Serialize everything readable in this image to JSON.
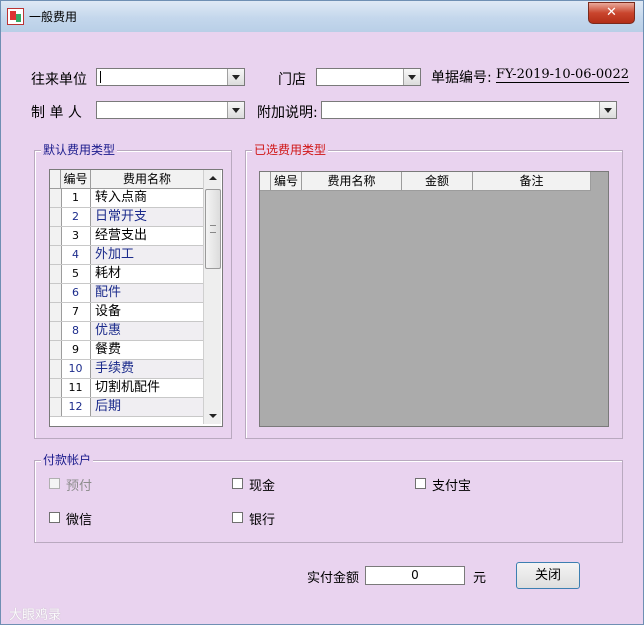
{
  "window": {
    "title": "一般费用",
    "close_symbol": "✕"
  },
  "form": {
    "partner_label": "往来单位",
    "partner_value": "",
    "store_label": "门店",
    "store_value": "",
    "bill_no_label": "单据编号:",
    "bill_no_value": "FY-2019-10-06-0022",
    "creator_label": "制 单 人",
    "creator_value": "",
    "note_label": "附加说明:",
    "note_value": ""
  },
  "default_types": {
    "title": "默认费用类型",
    "columns": [
      "编号",
      "费用名称"
    ],
    "rows": [
      {
        "no": "1",
        "name": "转入点商"
      },
      {
        "no": "2",
        "name": "日常开支"
      },
      {
        "no": "3",
        "name": "经营支出"
      },
      {
        "no": "4",
        "name": "外加工"
      },
      {
        "no": "5",
        "name": "耗材"
      },
      {
        "no": "6",
        "name": "配件"
      },
      {
        "no": "7",
        "name": "设备"
      },
      {
        "no": "8",
        "name": "优惠"
      },
      {
        "no": "9",
        "name": "餐费"
      },
      {
        "no": "10",
        "name": "手续费"
      },
      {
        "no": "11",
        "name": "切割机配件"
      },
      {
        "no": "12",
        "name": "后期"
      }
    ]
  },
  "selected_types": {
    "title": "已选费用类型",
    "columns": [
      "编号",
      "费用名称",
      "金额",
      "备注"
    ]
  },
  "payment": {
    "title": "付款帐户",
    "options": [
      {
        "label": "预付",
        "checked": false,
        "disabled": true
      },
      {
        "label": "现金",
        "checked": false,
        "disabled": false
      },
      {
        "label": "支付宝",
        "checked": false,
        "disabled": false
      },
      {
        "label": "微信",
        "checked": false,
        "disabled": false
      },
      {
        "label": "银行",
        "checked": false,
        "disabled": false
      }
    ]
  },
  "footer": {
    "amount_label": "实付金额",
    "amount_value": "0",
    "unit": "元",
    "close_label": "关闭"
  },
  "watermark": "大眼鸡录",
  "colors": {
    "window_bg": "#e9d3ef",
    "default_group_title": "#1a1a8c",
    "selected_group_title": "#d01515",
    "payment_group_title": "#1a1a8c",
    "selected_grid_bg": "#ababab"
  }
}
